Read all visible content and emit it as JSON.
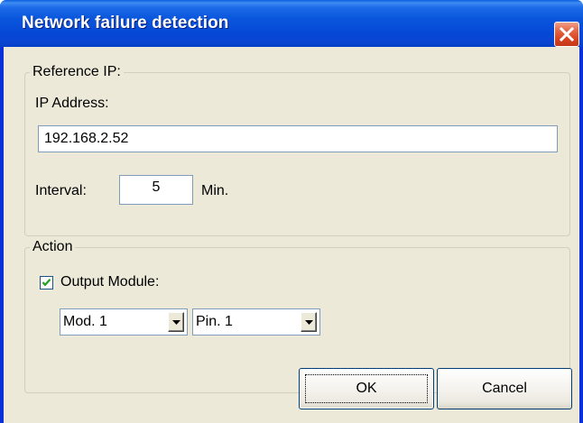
{
  "window": {
    "title": "Network failure detection"
  },
  "reference_ip": {
    "group_label": "Reference IP:",
    "ip_label": "IP Address:",
    "ip_value": "192.168.2.52",
    "interval_label": "Interval:",
    "interval_value": "5",
    "interval_unit": "Min."
  },
  "action": {
    "group_label": "Action",
    "output_module_label": "Output Module:",
    "output_module_checked": true,
    "module_select": "Mod. 1",
    "pin_select": "Pin. 1"
  },
  "buttons": {
    "ok": "OK",
    "cancel": "Cancel"
  },
  "colors": {
    "titlebar": "#0a56dc",
    "close_button": "#d9431f",
    "dialog_background": "#ece9d8"
  },
  "icons": {
    "close": "close-icon",
    "checkmark": "checkmark-icon",
    "dropdown": "chevron-down-icon"
  }
}
